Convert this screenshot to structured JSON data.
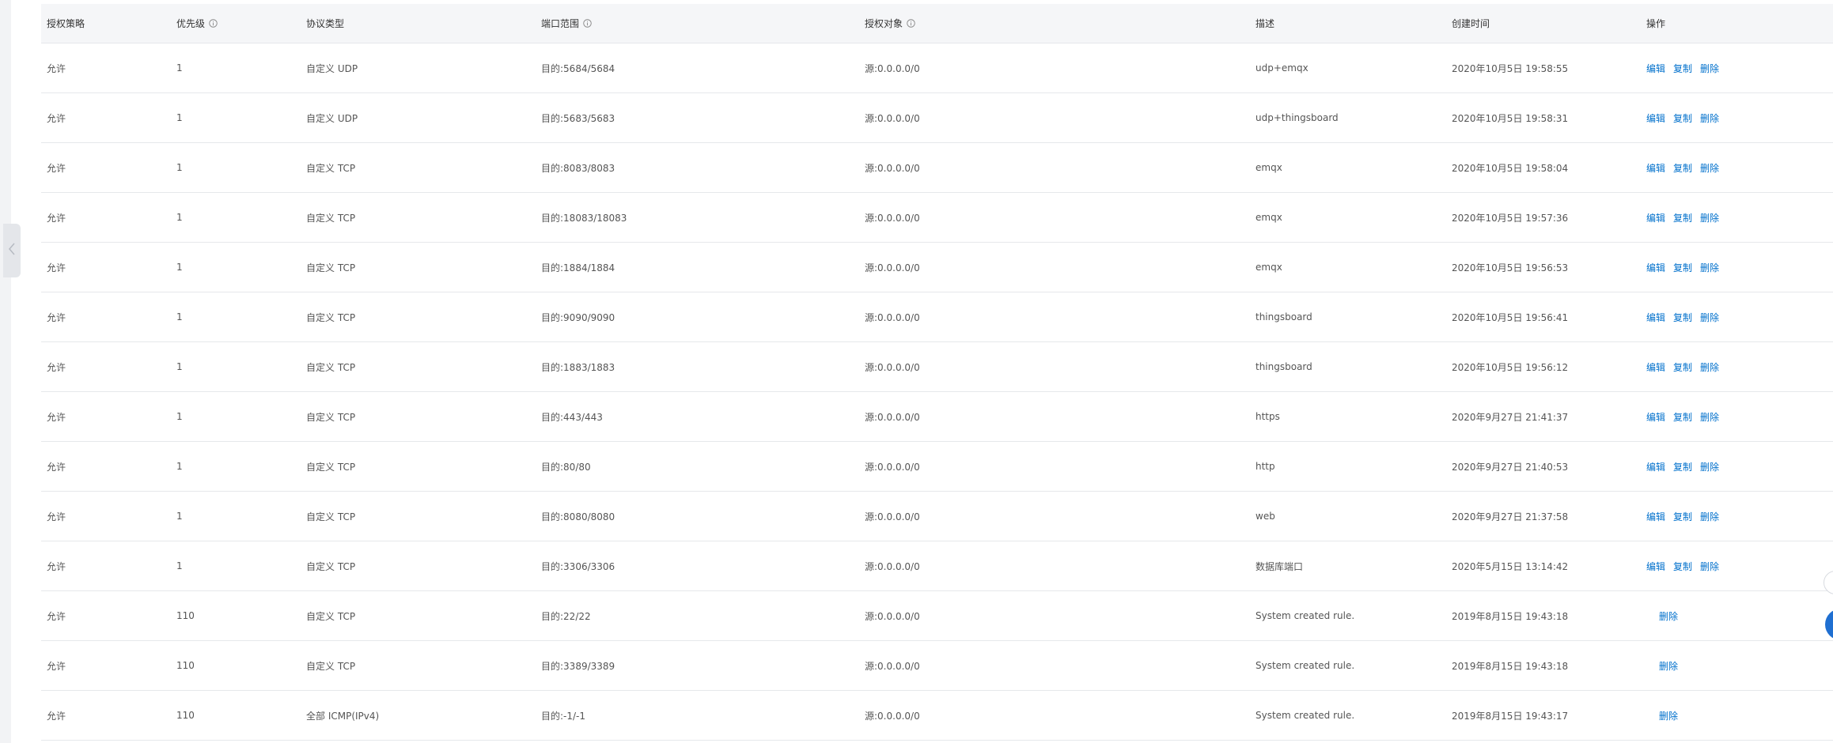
{
  "columns": {
    "policy": "授权策略",
    "priority": "优先级",
    "protocol": "协议类型",
    "port_range": "端口范围",
    "target": "授权对象",
    "description": "描述",
    "created": "创建时间",
    "actions": "操作"
  },
  "actions": {
    "edit": "编辑",
    "copy": "复制",
    "delete": "删除"
  },
  "rows": [
    {
      "policy": "允许",
      "priority": "1",
      "protocol": "自定义 UDP",
      "port": "目的:5684/5684",
      "target": "源:0.0.0.0/0",
      "description": "udp+emqx",
      "created": "2020年10月5日 19:58:55",
      "full_actions": true
    },
    {
      "policy": "允许",
      "priority": "1",
      "protocol": "自定义 UDP",
      "port": "目的:5683/5683",
      "target": "源:0.0.0.0/0",
      "description": "udp+thingsboard",
      "created": "2020年10月5日 19:58:31",
      "full_actions": true
    },
    {
      "policy": "允许",
      "priority": "1",
      "protocol": "自定义 TCP",
      "port": "目的:8083/8083",
      "target": "源:0.0.0.0/0",
      "description": "emqx",
      "created": "2020年10月5日 19:58:04",
      "full_actions": true
    },
    {
      "policy": "允许",
      "priority": "1",
      "protocol": "自定义 TCP",
      "port": "目的:18083/18083",
      "target": "源:0.0.0.0/0",
      "description": "emqx",
      "created": "2020年10月5日 19:57:36",
      "full_actions": true
    },
    {
      "policy": "允许",
      "priority": "1",
      "protocol": "自定义 TCP",
      "port": "目的:1884/1884",
      "target": "源:0.0.0.0/0",
      "description": "emqx",
      "created": "2020年10月5日 19:56:53",
      "full_actions": true
    },
    {
      "policy": "允许",
      "priority": "1",
      "protocol": "自定义 TCP",
      "port": "目的:9090/9090",
      "target": "源:0.0.0.0/0",
      "description": "thingsboard",
      "created": "2020年10月5日 19:56:41",
      "full_actions": true
    },
    {
      "policy": "允许",
      "priority": "1",
      "protocol": "自定义 TCP",
      "port": "目的:1883/1883",
      "target": "源:0.0.0.0/0",
      "description": "thingsboard",
      "created": "2020年10月5日 19:56:12",
      "full_actions": true
    },
    {
      "policy": "允许",
      "priority": "1",
      "protocol": "自定义 TCP",
      "port": "目的:443/443",
      "target": "源:0.0.0.0/0",
      "description": "https",
      "created": "2020年9月27日 21:41:37",
      "full_actions": true
    },
    {
      "policy": "允许",
      "priority": "1",
      "protocol": "自定义 TCP",
      "port": "目的:80/80",
      "target": "源:0.0.0.0/0",
      "description": "http",
      "created": "2020年9月27日 21:40:53",
      "full_actions": true
    },
    {
      "policy": "允许",
      "priority": "1",
      "protocol": "自定义 TCP",
      "port": "目的:8080/8080",
      "target": "源:0.0.0.0/0",
      "description": "web",
      "created": "2020年9月27日 21:37:58",
      "full_actions": true
    },
    {
      "policy": "允许",
      "priority": "1",
      "protocol": "自定义 TCP",
      "port": "目的:3306/3306",
      "target": "源:0.0.0.0/0",
      "description": "数据库端口",
      "created": "2020年5月15日 13:14:42",
      "full_actions": true
    },
    {
      "policy": "允许",
      "priority": "110",
      "protocol": "自定义 TCP",
      "port": "目的:22/22",
      "target": "源:0.0.0.0/0",
      "description": "System created rule.",
      "created": "2019年8月15日 19:43:18",
      "full_actions": false
    },
    {
      "policy": "允许",
      "priority": "110",
      "protocol": "自定义 TCP",
      "port": "目的:3389/3389",
      "target": "源:0.0.0.0/0",
      "description": "System created rule.",
      "created": "2019年8月15日 19:43:18",
      "full_actions": false
    },
    {
      "policy": "允许",
      "priority": "110",
      "protocol": "全部 ICMP(IPv4)",
      "port": "目的:-1/-1",
      "target": "源:0.0.0.0/0",
      "description": "System created rule.",
      "created": "2019年8月15日 19:43:17",
      "full_actions": false
    }
  ],
  "colors": {
    "link": "#0070cc",
    "header_bg": "#f5f6f8",
    "border": "#e6e8eb",
    "fab": "#1f6fd1"
  }
}
